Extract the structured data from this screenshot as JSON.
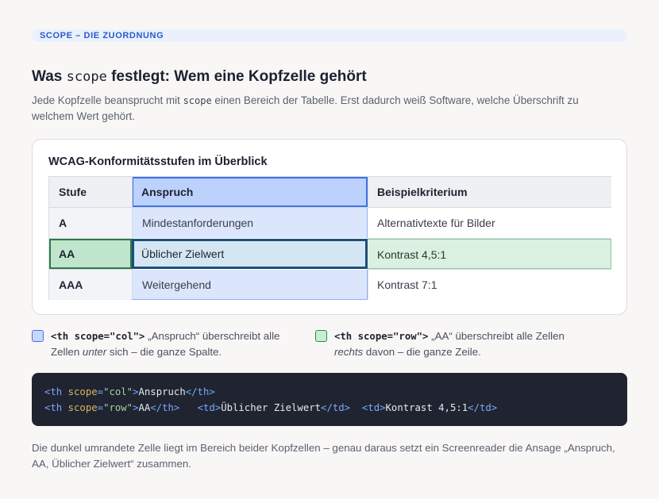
{
  "eyebrow": "SCOPE – DIE ZUORDNUNG",
  "title": {
    "pre": "Was ",
    "code": "scope",
    "post": " festlegt: Wem eine Kopfzelle gehört"
  },
  "intro": {
    "pre": "Jede Kopfzelle beansprucht mit ",
    "code": "scope",
    "post": " einen Bereich der Tabelle. Erst dadurch weiß Software, welche Überschrift zu welchem Wert gehört."
  },
  "table": {
    "caption": "WCAG-Konformitätsstufen im Überblick",
    "headers": [
      "Stufe",
      "Anspruch",
      "Beispielkriterium"
    ],
    "rows": [
      [
        "A",
        "Mindestanforderungen",
        "Alternativtexte für Bilder"
      ],
      [
        "AA",
        "Üblicher Zielwert",
        "Kontrast 4,5:1"
      ],
      [
        "AAA",
        "Weitergehend",
        "Kontrast 7:1"
      ]
    ]
  },
  "legend": {
    "col": {
      "code": "<th scope=\"col\">",
      "text1": " „Anspruch“ überschreibt alle",
      "text2a": "Zellen ",
      "text2em": "unter",
      "text2b": " sich – die ganze Spalte.",
      "color": "#3d73e6"
    },
    "row": {
      "code": "<th scope=\"row\">",
      "text1": " „AA“ überschreibt alle Zellen",
      "text2em": "rechts",
      "text2b": " davon – die ganze Zeile.",
      "color": "#2e8a52"
    }
  },
  "code": {
    "line1": {
      "open": "<th",
      "attr": "scope",
      "eq": "=",
      "val": "\"col\"",
      "close": ">",
      "text": "Anspruch",
      "end": "</th>"
    },
    "line2": {
      "open": "<th",
      "attr": "scope",
      "eq": "=",
      "val": "\"row\"",
      "close": ">",
      "text": "AA",
      "end": "</th>",
      "td1_open": "<td>",
      "td1_text": "Üblicher Zielwert",
      "td1_end": "</td>",
      "td2_open": "<td>",
      "td2_text": "Kontrast 4,5:1",
      "td2_end": "</td>"
    }
  },
  "footer": "Die dunkel umrandete Zelle liegt im Bereich beider Kopfzellen – genau daraus setzt ein Screenreader die Ansage „Anspruch, AA, Üblicher Zielwert“ zusammen.",
  "colors": {
    "accent_blue": "#2a5bc6",
    "col_highlight": "#dbe6fd",
    "row_highlight": "#daf0e1",
    "target_border": "#1d4f7a"
  }
}
